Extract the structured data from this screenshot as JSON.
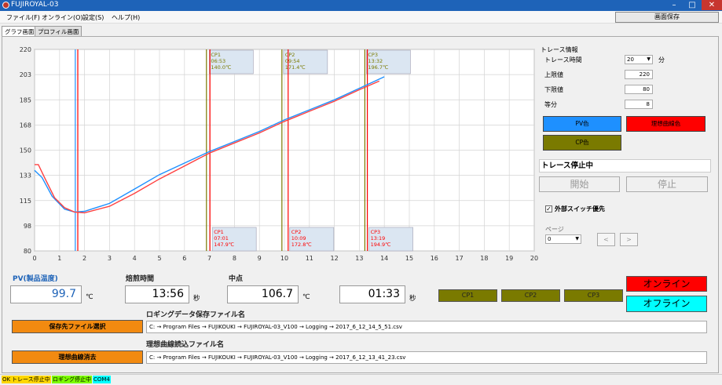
{
  "window": {
    "title": "FUJIROYAL-03",
    "minimize": "–",
    "maximize": "□",
    "close": "✕"
  },
  "menu": {
    "items": [
      "ファイル(F)",
      "オンライン(O)",
      "設定(S)",
      "ヘルプ(H)"
    ]
  },
  "toolbar": {
    "save_screen": "画面保存"
  },
  "tabs": [
    "グラフ画面",
    "プロフィル画面"
  ],
  "trace": {
    "header": "トレース情報",
    "time_label": "トレース時間",
    "time_value": "20",
    "time_unit": "分",
    "upper_label": "上限値",
    "upper_value": "220",
    "lower_label": "下限値",
    "lower_value": "80",
    "div_label": "等分",
    "div_value": "8",
    "pv_color": "PV色",
    "ideal_color": "理想曲線色",
    "cp_color": "CP色",
    "status": "トレース停止中",
    "start": "開始",
    "stop": "停止",
    "ext_switch": "外部スイッチ優先",
    "page_label": "ページ",
    "page_value": "0",
    "prev": "<",
    "next": ">"
  },
  "colors": {
    "pv": "#1e90ff",
    "ideal": "#ff0000",
    "cp": "#7a7a00",
    "online": "#ff0000",
    "offline": "#00ffff"
  },
  "readouts": {
    "pv_label": "PV(製品温度)",
    "pv_value": "99.7",
    "pv_unit": "℃",
    "roast_label": "焙煎時間",
    "roast_value": "13:56",
    "roast_unit": "秒",
    "mid_label": "中点",
    "mid_value": "106.7",
    "mid_unit": "℃",
    "mid_time": "01:33",
    "mid_time_unit": "秒"
  },
  "cp_buttons": [
    "CP1",
    "CP2",
    "CP3"
  ],
  "online": "オンライン",
  "offline": "オフライン",
  "files": {
    "save_btn": "保存先ファイル選択",
    "log_label": "ロギングデータ保存ファイル名",
    "log_path": "C: → Program Files → FUJIKOUKI → FUJIROYAL-03_V100 → Logging → 2017_6_12_14_5_51.csv",
    "clear_btn": "理想曲線消去",
    "ideal_label": "理想曲線読込ファイル名",
    "ideal_path": "C: → Program Files → FUJIKOUKI → FUJIROYAL-03_V100 → Logging → 2017_6_12_13_41_23.csv"
  },
  "status": [
    {
      "text": "OK",
      "color": "#ffd700"
    },
    {
      "text": "トレース停止中",
      "color": "#ffd700"
    },
    {
      "text": "ロギング停止中",
      "color": "#7cfc00"
    },
    {
      "text": "COM4",
      "color": "#00ffff"
    }
  ],
  "chart_data": {
    "type": "line",
    "xlim": [
      0,
      20
    ],
    "ylim": [
      80,
      220
    ],
    "x_ticks": [
      "0",
      "1",
      "2",
      "3",
      "4",
      "5",
      "6",
      "7",
      "8",
      "9",
      "10",
      "11",
      "12",
      "13",
      "14",
      "15",
      "16",
      "17",
      "18",
      "19",
      "20"
    ],
    "y_ticks": [
      "220",
      "203",
      "185",
      "168",
      "150",
      "133",
      "115",
      "98",
      "80"
    ],
    "grid": true,
    "series": [
      {
        "color": "#1e90ff",
        "points": [
          [
            0,
            136
          ],
          [
            0.3,
            131
          ],
          [
            0.7,
            118
          ],
          [
            1.2,
            109
          ],
          [
            1.6,
            107
          ],
          [
            2.0,
            107.5
          ],
          [
            3,
            113
          ],
          [
            4,
            123
          ],
          [
            5,
            133
          ],
          [
            6,
            141
          ],
          [
            7,
            149
          ],
          [
            8,
            156
          ],
          [
            9,
            163
          ],
          [
            10,
            171
          ],
          [
            11,
            178
          ],
          [
            12,
            185
          ],
          [
            13,
            193
          ],
          [
            13.5,
            197
          ],
          [
            14,
            201
          ]
        ]
      },
      {
        "color": "#ff4040",
        "points": [
          [
            0,
            140
          ],
          [
            0.15,
            140
          ],
          [
            0.4,
            131
          ],
          [
            0.8,
            117
          ],
          [
            1.2,
            110
          ],
          [
            1.6,
            107
          ],
          [
            2.0,
            106.5
          ],
          [
            3,
            111
          ],
          [
            4,
            120
          ],
          [
            5,
            130
          ],
          [
            6,
            139
          ],
          [
            7,
            148
          ],
          [
            8,
            155
          ],
          [
            9,
            162
          ],
          [
            10,
            170
          ],
          [
            11,
            177
          ],
          [
            12,
            184
          ],
          [
            13,
            192
          ],
          [
            13.8,
            198
          ]
        ]
      }
    ],
    "vlines": [
      {
        "x": 1.63,
        "color": "#1e90ff"
      },
      {
        "x": 1.73,
        "color": "#ff0000"
      },
      {
        "x": 6.88,
        "color": "#7a7a00"
      },
      {
        "x": 7.02,
        "color": "#ff0000"
      },
      {
        "x": 9.9,
        "color": "#7a7a00"
      },
      {
        "x": 10.15,
        "color": "#ff0000"
      },
      {
        "x": 13.22,
        "color": "#7a7a00"
      },
      {
        "x": 13.32,
        "color": "#ff0000"
      }
    ],
    "annotations": [
      {
        "x": 6.93,
        "pos": "top",
        "lines": [
          "CP1",
          "06:53",
          "140.0℃"
        ],
        "color": "#7a7a00"
      },
      {
        "x": 9.9,
        "pos": "top",
        "lines": [
          "CP2",
          "09:54",
          "171.4℃"
        ],
        "color": "#7a7a00"
      },
      {
        "x": 13.22,
        "pos": "top",
        "lines": [
          "CP3",
          "13:32",
          "196.7℃"
        ],
        "color": "#7a7a00"
      },
      {
        "x": 7.05,
        "pos": "bottom",
        "lines": [
          "CP1",
          "07:01",
          "147.9℃"
        ],
        "color": "#ff0000"
      },
      {
        "x": 10.15,
        "pos": "bottom",
        "lines": [
          "CP2",
          "10:09",
          "172.8℃"
        ],
        "color": "#ff0000"
      },
      {
        "x": 13.32,
        "pos": "bottom",
        "lines": [
          "CP3",
          "13:19",
          "194.9℃"
        ],
        "color": "#ff0000"
      }
    ]
  }
}
